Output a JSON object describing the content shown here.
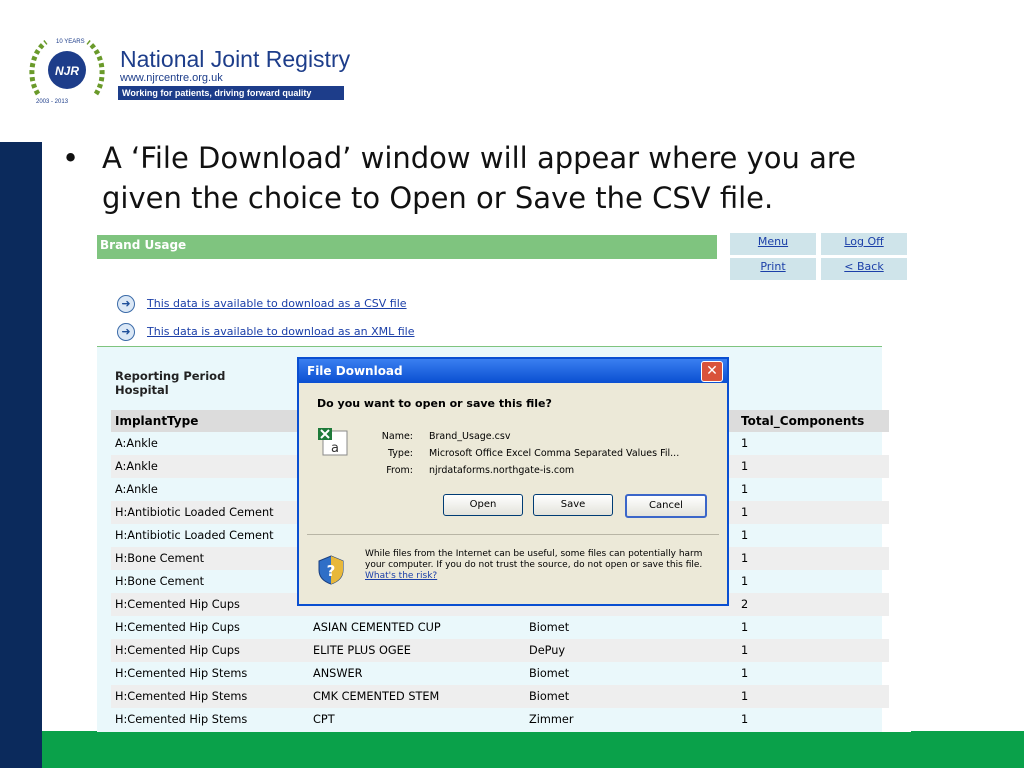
{
  "logo": {
    "badge": "NJR",
    "ring_top": "10 YEARS",
    "ring_bottom": "2003 - 2013",
    "title": "National Joint Registry",
    "url": "www.njrcentre.org.uk",
    "tagline": "Working for patients, driving forward quality"
  },
  "bullet": {
    "dot": "•",
    "text": "A ‘File Download’ window will appear where you are given the choice to Open or Save the CSV file."
  },
  "page": {
    "title": "Brand Usage",
    "nav": [
      "Menu",
      "Log Off",
      "Print",
      "< Back"
    ],
    "downloads": [
      "This data is available to download as a CSV file",
      "This data is available to download as an XML file"
    ],
    "labels": [
      "Reporting Period",
      "Hospital"
    ]
  },
  "table": {
    "headers": [
      "ImplantType",
      "",
      "",
      "Total_Components"
    ],
    "rows": [
      [
        "A:Ankle",
        "",
        "",
        "1"
      ],
      [
        "A:Ankle",
        "",
        "",
        "1"
      ],
      [
        "A:Ankle",
        "",
        "",
        "1"
      ],
      [
        "H:Antibiotic Loaded Cement",
        "",
        "",
        "1"
      ],
      [
        "H:Antibiotic Loaded Cement",
        "",
        "",
        "1"
      ],
      [
        "H:Bone Cement",
        "",
        "",
        "1"
      ],
      [
        "H:Bone Cement",
        "",
        "",
        "1"
      ],
      [
        "H:Cemented Hip Cups",
        "",
        "",
        "2"
      ],
      [
        "H:Cemented Hip Cups",
        "ASIAN CEMENTED CUP",
        "Biomet",
        "1"
      ],
      [
        "H:Cemented Hip Cups",
        "ELITE PLUS OGEE",
        "DePuy",
        "1"
      ],
      [
        "H:Cemented Hip Stems",
        "ANSWER",
        "Biomet",
        "1"
      ],
      [
        "H:Cemented Hip Stems",
        "CMK CEMENTED STEM",
        "Biomet",
        "1"
      ],
      [
        "H:Cemented Hip Stems",
        "CPT",
        "Zimmer",
        "1"
      ]
    ]
  },
  "dialog": {
    "title": "File Download",
    "close": "✕",
    "question": "Do you want to open or save this file?",
    "name_label": "Name:",
    "name_value": "Brand_Usage.csv",
    "type_label": "Type:",
    "type_value": "Microsoft Office Excel Comma Separated Values Fil...",
    "from_label": "From:",
    "from_value": "njrdataforms.northgate-is.com",
    "buttons": [
      "Open",
      "Save",
      "Cancel"
    ],
    "warning": "While files from the Internet can be useful, some files can potentially harm your computer. If you do not trust the source, do not open or save this file.",
    "risk_link": "What's the risk?"
  },
  "colors": {
    "navy": "#0b2a5c",
    "green": "#0aa14a",
    "brand_green": "#7fc47f",
    "dialog_blue": "#0a4fd1"
  }
}
